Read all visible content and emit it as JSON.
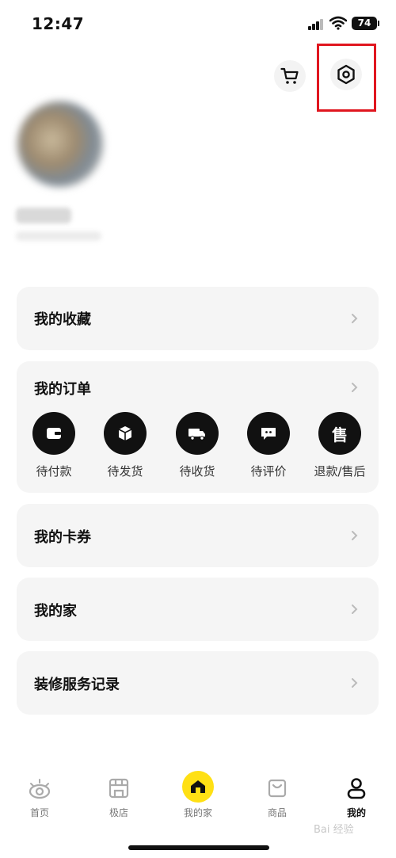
{
  "status_bar": {
    "time": "12:47",
    "battery": "74"
  },
  "header": {
    "cart_icon": "cart-icon",
    "settings_icon": "settings-hexagon-icon"
  },
  "menu": {
    "favorites": "我的收藏",
    "orders": "我的订单",
    "coupons": "我的卡券",
    "home": "我的家",
    "renovation": "装修服务记录"
  },
  "order_status": [
    {
      "label": "待付款",
      "icon": "wallet-icon"
    },
    {
      "label": "待发货",
      "icon": "box-icon"
    },
    {
      "label": "待收货",
      "icon": "truck-icon"
    },
    {
      "label": "待评价",
      "icon": "comment-icon"
    },
    {
      "label": "退款/售后",
      "icon": "after-sale-icon",
      "glyph": "售"
    }
  ],
  "tabbar": [
    {
      "label": "首页",
      "icon": "eye-icon"
    },
    {
      "label": "极店",
      "icon": "store-icon"
    },
    {
      "label": "我的家",
      "icon": "house-icon"
    },
    {
      "label": "商品",
      "icon": "bag-icon"
    },
    {
      "label": "我的",
      "icon": "person-icon",
      "active": true
    }
  ],
  "watermark": "Bai 经验"
}
